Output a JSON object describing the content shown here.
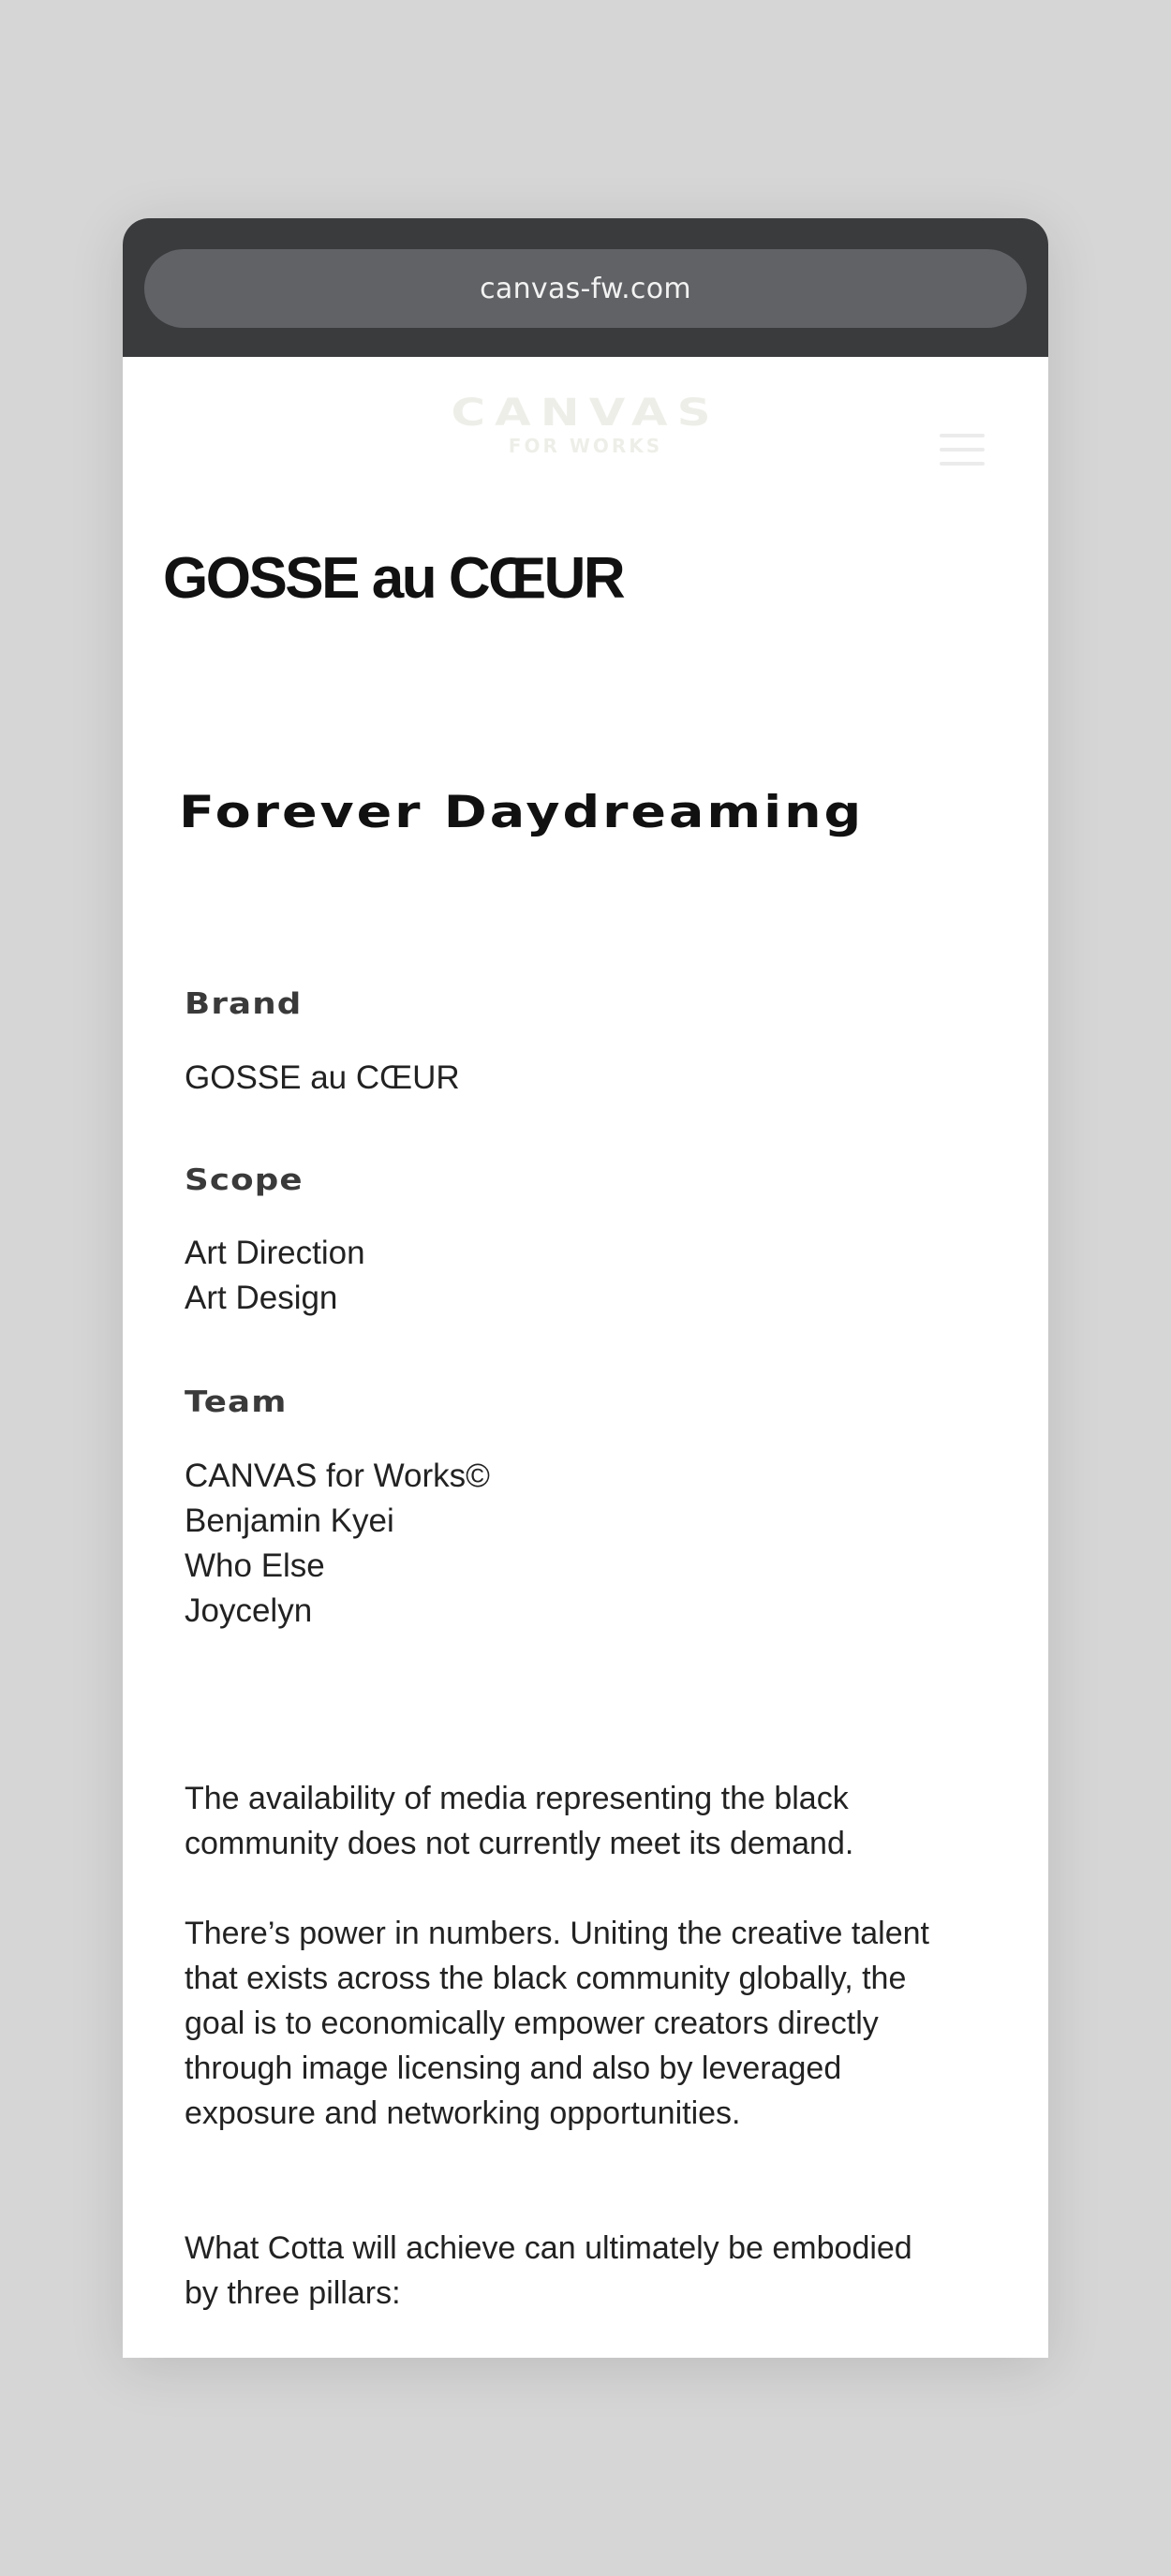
{
  "browser": {
    "url": "canvas-fw.com"
  },
  "header": {
    "logo_main": "CANVAS",
    "logo_sub": "FOR WORKS"
  },
  "page": {
    "brand_title": "GOSSE au CŒUR",
    "project_title": "Forever Daydreaming"
  },
  "meta": {
    "brand_label": "Brand",
    "brand_values": [
      "GOSSE au CŒUR"
    ],
    "scope_label": "Scope",
    "scope_values": [
      "Art Direction",
      "Art Design"
    ],
    "team_label": "Team",
    "team_values": [
      "CANVAS for Works©",
      "Benjamin Kyei",
      "Who Else",
      "Joycelyn"
    ]
  },
  "body": {
    "paragraphs": [
      "The availability of media representing the black community does not currently meet its demand.",
      "There’s power in numbers. Uniting the creative talent that exists across the black community globally, the goal is to economically empower creators directly through image licensing and also by leveraged exposure and networking opportunities.",
      "What Cotta will achieve can ultimately be embodied by three pillars:"
    ]
  }
}
